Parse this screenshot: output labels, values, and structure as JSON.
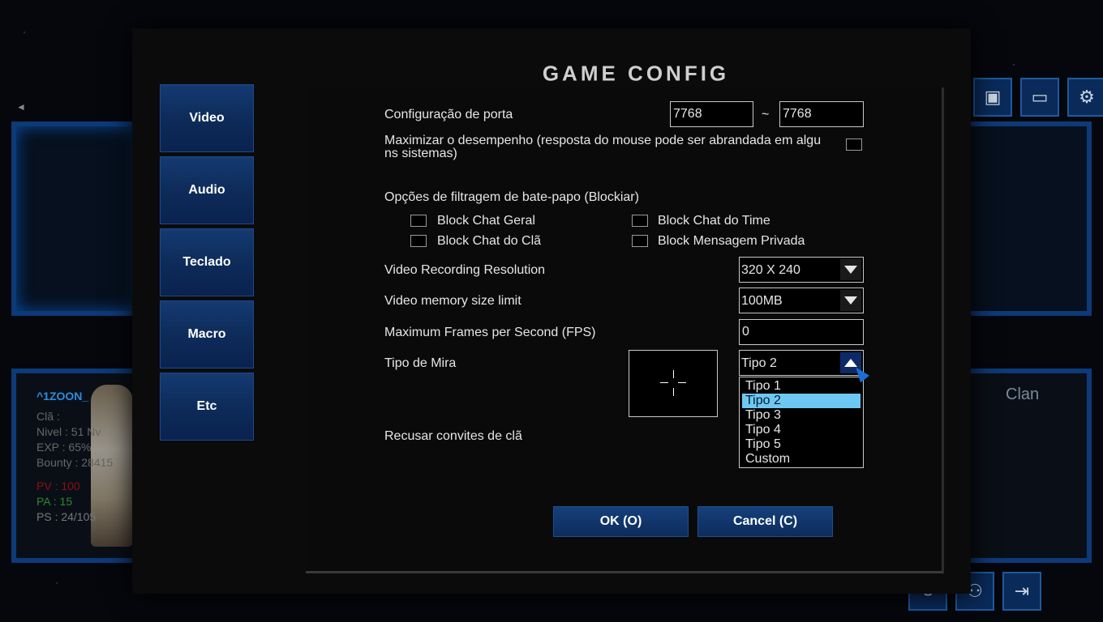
{
  "background": {
    "character": {
      "name": "^1ZOON_",
      "clan": "Clã :",
      "level": "Nivel : 51 Nv",
      "exp": "EXP : 65%",
      "bounty": "Bounty : 28415",
      "pv": "PV : 100",
      "pa": "PA : 15",
      "ps": "PS : 24/105"
    },
    "clan_tab": "Clan",
    "left_arrow": "◄",
    "top_icons": [
      "camera-icon",
      "tv-icon",
      "gear-icon"
    ],
    "bottom_icons": [
      "refresh-icon",
      "people-icon",
      "exit-icon"
    ]
  },
  "dialog": {
    "title": "GAME CONFIG",
    "tabs": [
      {
        "label": "Video"
      },
      {
        "label": "Audio"
      },
      {
        "label": "Teclado"
      },
      {
        "label": "Macro"
      },
      {
        "label": "Etc"
      }
    ],
    "port": {
      "label": "Configuração de porta",
      "from": "7768",
      "separator": "~",
      "to": "7768"
    },
    "maximize": {
      "label_line1": "Maximizar o desempenho (resposta do mouse pode ser abrandada em algu",
      "label_line2": "ns sistemas)",
      "checked": false
    },
    "chat_filter": {
      "label": "Opções de filtragem de bate-papo (Blockiar)",
      "options": [
        {
          "label": "Block Chat Geral",
          "checked": false
        },
        {
          "label": "Block Chat do Time",
          "checked": false
        },
        {
          "label": "Block Chat do Clã",
          "checked": false
        },
        {
          "label": "Block Mensagem Privada",
          "checked": false
        }
      ]
    },
    "video_resolution": {
      "label": "Video Recording Resolution",
      "value": "320 X 240"
    },
    "video_memory": {
      "label": "Video memory size limit",
      "value": "100MB"
    },
    "fps": {
      "label": "Maximum Frames per Second (FPS)",
      "value": "0"
    },
    "crosshair": {
      "label": "Tipo de Mira",
      "value": "Tipo 2",
      "options": [
        "Tipo 1",
        "Tipo 2",
        "Tipo 3",
        "Tipo 4",
        "Tipo 5",
        "Custom"
      ],
      "selected_index": 1
    },
    "refuse_clan": {
      "label": "Recusar convites de clã"
    },
    "ok_label": "OK (O)",
    "cancel_label": "Cancel (C)"
  },
  "colors": {
    "accent_blue": "#0d2c5c",
    "selected_option": "#6ec9f2",
    "pv_red": "#8a1010",
    "pa_green": "#2a8a2a"
  }
}
